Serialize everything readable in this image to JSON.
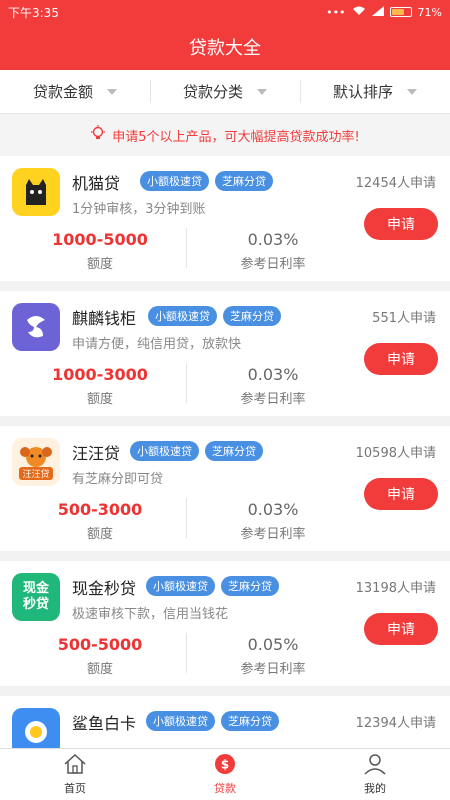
{
  "status": {
    "time": "下午3:35",
    "battery": "71%",
    "battery_level": 0.71
  },
  "title": "贷款大全",
  "filters": [
    "贷款金额",
    "贷款分类",
    "默认排序"
  ],
  "notice": "申请5个以上产品，可大幅提高贷款成功率!",
  "products": [
    {
      "name": "机猫贷",
      "tags": [
        "小额极速贷",
        "芝麻分贷"
      ],
      "count": "12454人申请",
      "desc": "1分钟审核，3分钟到账",
      "amount": "1000-5000",
      "amount_label": "额度",
      "rate": "0.03%",
      "rate_label": "参考日利率",
      "button": "申请"
    },
    {
      "name": "麒麟钱柜",
      "tags": [
        "小额极速贷",
        "芝麻分贷"
      ],
      "count": "551人申请",
      "desc": "申请方便，纯信用贷，放款快",
      "amount": "1000-3000",
      "amount_label": "额度",
      "rate": "0.03%",
      "rate_label": "参考日利率",
      "button": "申请"
    },
    {
      "name": "汪汪贷",
      "tags": [
        "小额极速贷",
        "芝麻分贷"
      ],
      "count": "10598人申请",
      "desc": "有芝麻分即可贷",
      "amount": "500-3000",
      "amount_label": "额度",
      "rate": "0.03%",
      "rate_label": "参考日利率",
      "button": "申请"
    },
    {
      "name": "现金秒贷",
      "tags": [
        "小额极速贷",
        "芝麻分贷"
      ],
      "count": "13198人申请",
      "desc": "极速审核下款，信用当钱花",
      "amount": "500-5000",
      "amount_label": "额度",
      "rate": "0.05%",
      "rate_label": "参考日利率",
      "button": "申请"
    },
    {
      "name": "鲨鱼白卡",
      "tags": [
        "小额极速贷",
        "芝麻分贷"
      ],
      "count": "12394人申请",
      "desc": "",
      "amount": "",
      "amount_label": "",
      "rate": "",
      "rate_label": "",
      "button": ""
    }
  ],
  "logo_text": {
    "xianjin": "现金",
    "miaodai": "秒贷",
    "wangwang": "汪汪贷"
  },
  "tabs": [
    {
      "label": "首页",
      "icon": "home-icon"
    },
    {
      "label": "贷款",
      "icon": "dollar-icon"
    },
    {
      "label": "我的",
      "icon": "user-icon"
    }
  ],
  "colors": {
    "brand": "#f23b3b",
    "tag": "#4a90e2"
  }
}
